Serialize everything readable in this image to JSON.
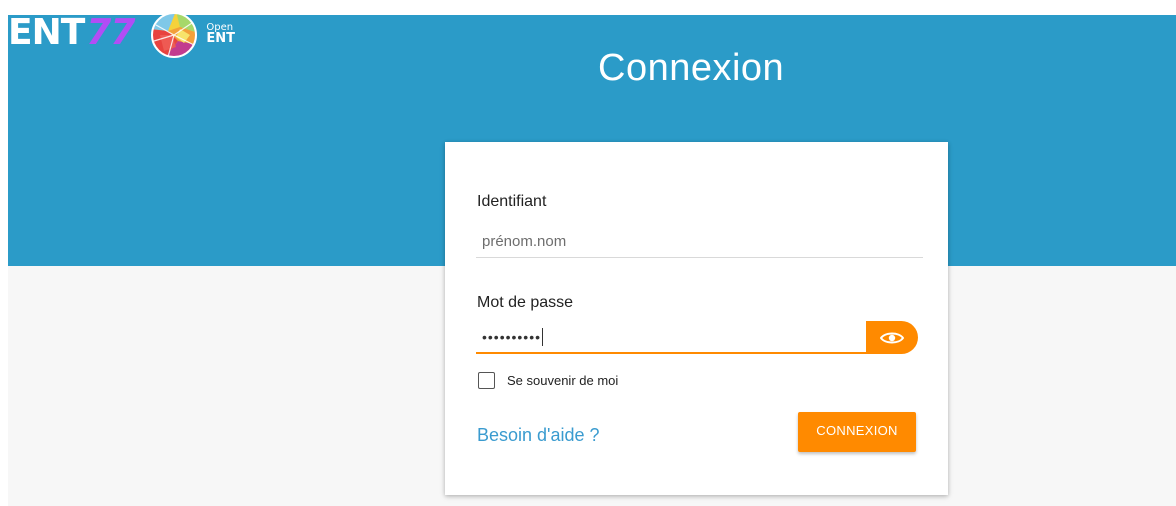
{
  "colors": {
    "header_bg": "#2b9bc8",
    "accent": "#ff8a00",
    "link": "#3a9bcf",
    "logo_digit": "#b14df5"
  },
  "logo": {
    "ent_text": "ENT",
    "ent_digit": "77",
    "open_small": "Open",
    "open_big": "ENT"
  },
  "header": {
    "title": "Connexion"
  },
  "form": {
    "identifier": {
      "label": "Identifiant",
      "placeholder": "prénom.nom",
      "value": ""
    },
    "password": {
      "label": "Mot de passe",
      "masked_value": "••••••••••",
      "toggle_icon": "eye-icon"
    },
    "remember": {
      "label": "Se souvenir de moi",
      "checked": false
    },
    "help_link": "Besoin d'aide ?",
    "submit_label": "CONNEXION"
  }
}
